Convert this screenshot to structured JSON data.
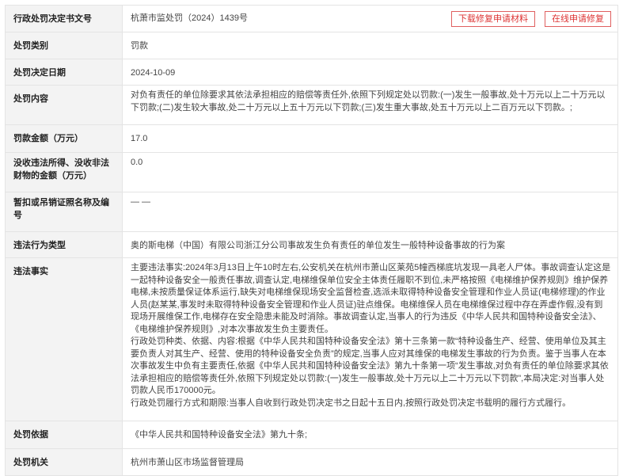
{
  "rows": {
    "doc_no": {
      "label": "行政处罚决定书文号",
      "value": "杭萧市监处罚（2024）1439号"
    },
    "type": {
      "label": "处罚类别",
      "value": "罚款"
    },
    "date": {
      "label": "处罚决定日期",
      "value": "2024-10-09"
    },
    "content": {
      "label": "处罚内容",
      "value": "对负有责任的单位除要求其依法承担相应的赔偿等责任外,依照下列规定处以罚款:(一)发生一般事故,处十万元以上二十万元以下罚款;(二)发生较大事故,处二十万元以上五十万元以下罚款;(三)发生重大事故,处五十万元以上二百万元以下罚款。;"
    },
    "fine": {
      "label": "罚款金额（万元）",
      "value": "17.0"
    },
    "confiscate": {
      "label": "没收违法所得、没收非法财物的金额（万元）",
      "value": "0.0"
    },
    "suspend": {
      "label": "暂扣或吊销证照名称及编号",
      "value": "— —"
    },
    "violation_type": {
      "label": "违法行为类型",
      "value": "奥的斯电梯（中国）有限公司浙江分公司事故发生负有责任的单位发生一般特种设备事故的行为案"
    },
    "facts": {
      "label": "违法事实",
      "p1": "主要违法事实:2024年3月13日上午10时左右,公安机关在杭州市萧山区莱苑5幢西梯底坑发现一具老人尸体。事故调查认定这是一起特种设备安全一般责任事故,调查认定,电梯维保单位安全主体责任履职不到位,未严格按照《电梯维护保养规则》维护保养电梯,未按质量保证体系运行,缺失对电梯维保现场安全监督检查,选派未取得特种设备安全管理和作业人员证(电梯修理)的作业人员(赵某某,事发时未取得特种设备安全管理和作业人员证)驻点维保。电梯维保人员在电梯维保过程中存在弄虚作假,没有到现场开展维保工作,电梯存在安全隐患未能及时消除。事故调查认定,当事人的行为违反《中华人民共和国特种设备安全法》、《电梯维护保养规则》,对本次事故发生负主要责任。",
      "p2": "行政处罚种类、依据、内容:根据《中华人民共和国特种设备安全法》第十三条第一款“特种设备生产、经营、使用单位及其主要负责人对其生产、经营、使用的特种设备安全负责”的规定,当事人应对其维保的电梯发生事故的行为负责。鉴于当事人在本次事故发生中负有主要责任,依据《中华人民共和国特种设备安全法》第九十条第一项“发生事故,对负有责任的单位除要求其依法承担相应的赔偿等责任外,依照下列规定处以罚款:(一)发生一般事故,处十万元以上二十万元以下罚款”,本局决定:对当事人处罚款人民币170000元。",
      "p3": "行政处罚履行方式和期限:当事人自收到行政处罚决定书之日起十五日内,按照行政处罚决定书载明的履行方式履行。"
    },
    "basis": {
      "label": "处罚依据",
      "value": "《中华人民共和国特种设备安全法》第九十条;"
    },
    "authority": {
      "label": "处罚机关",
      "value": "杭州市萧山区市场监督管理局"
    }
  },
  "buttons": {
    "download": "下载修复申请材料",
    "apply": "在线申请修复"
  },
  "colors": {
    "label_bg": "#f3f3f3",
    "border": "#e4e4e4",
    "button_red": "#d33333"
  }
}
